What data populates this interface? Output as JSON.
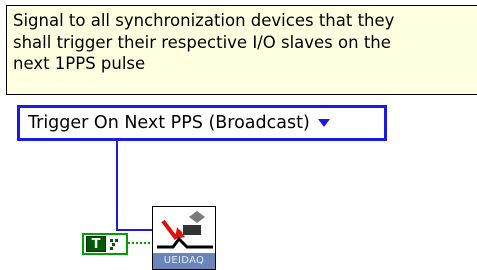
{
  "comment": {
    "lines": [
      "Signal to all synchronization devices that they",
      "shall trigger their respective I/O slaves on the",
      "next 1PPS pulse"
    ]
  },
  "ring_control": {
    "selected_value": "Trigger On Next PPS (Broadcast)"
  },
  "boolean_constant": {
    "label": "T"
  },
  "subvi": {
    "banner_text": "UEIDAQ",
    "icon": "trigger-signal-icon"
  },
  "colors": {
    "comment_bg": "#ffffe1",
    "ring_border": "#1a1ae6",
    "wire_enum": "#1a1ae6",
    "wire_bool": "#00a000",
    "bool_fill": "#005a00",
    "subvi_banner": "#6a86b8"
  }
}
